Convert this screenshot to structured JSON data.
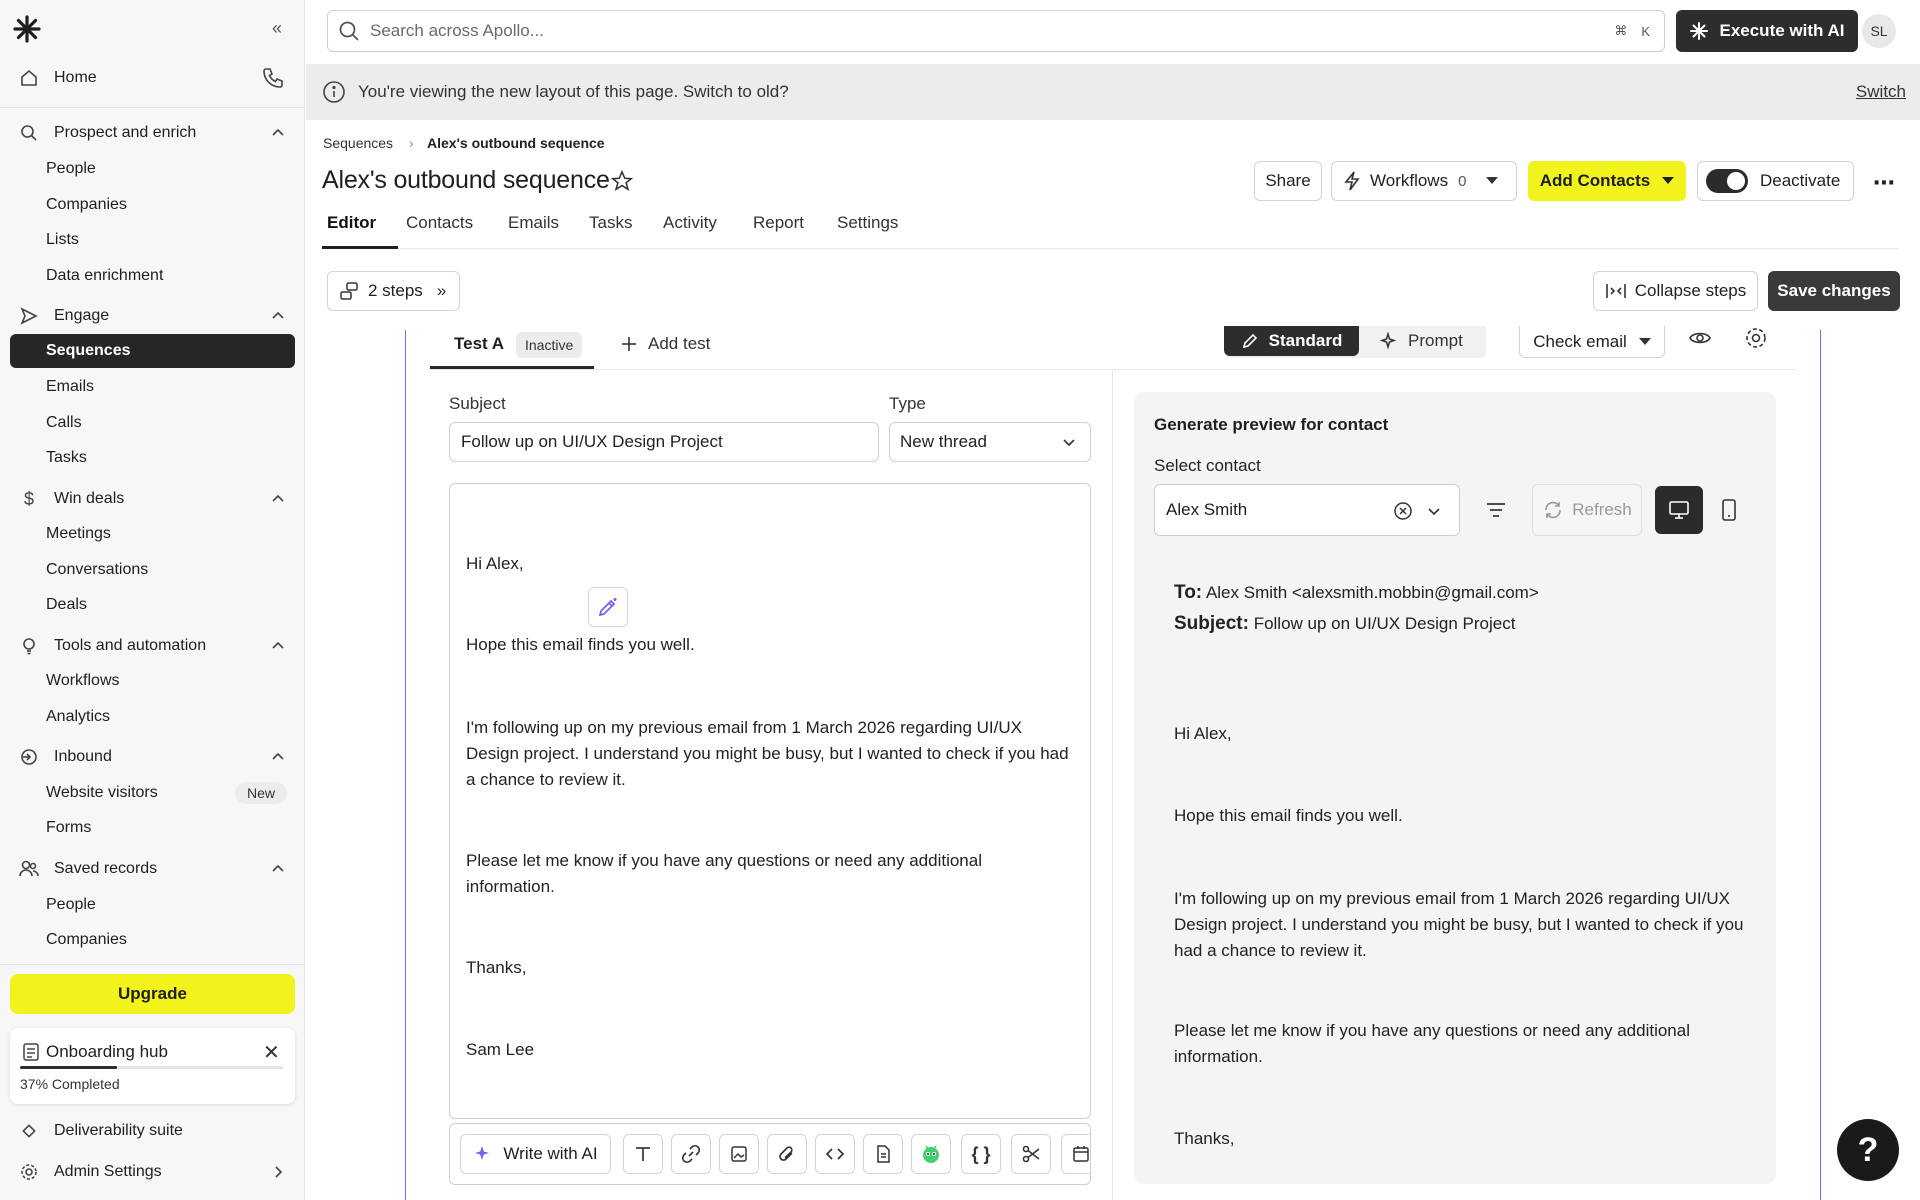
{
  "sidebar": {
    "home": "Home",
    "sections": {
      "prospect": "Prospect and enrich",
      "engage": "Engage",
      "win": "Win deals",
      "tools": "Tools and automation",
      "inbound": "Inbound",
      "saved": "Saved records"
    },
    "items": {
      "people": "People",
      "companies": "Companies",
      "lists": "Lists",
      "data_enrichment": "Data enrichment",
      "sequences": "Sequences",
      "emails": "Emails",
      "calls": "Calls",
      "tasks": "Tasks",
      "meetings": "Meetings",
      "conversations": "Conversations",
      "deals": "Deals",
      "workflows": "Workflows",
      "analytics": "Analytics",
      "website_visitors": "Website visitors",
      "new_badge": "New",
      "forms": "Forms",
      "saved_people": "People",
      "saved_companies": "Companies"
    },
    "upgrade": "Upgrade",
    "onboarding": {
      "title": "Onboarding hub",
      "progress_text": "37% Completed",
      "progress": 0.37
    },
    "deliverability": "Deliverability suite",
    "admin": "Admin Settings"
  },
  "topbar": {
    "search_placeholder": "Search across Apollo...",
    "shortcut_cmd": "⌘",
    "shortcut_key": "K",
    "execute_ai": "Execute with AI",
    "avatar": "SL"
  },
  "banner": {
    "text": "You're viewing the new layout of this page. Switch to old?",
    "link": "Switch"
  },
  "header": {
    "breadcrumb_root": "Sequences",
    "breadcrumb_current": "Alex's outbound sequence",
    "title": "Alex's outbound sequence",
    "share": "Share",
    "workflows": "Workflows",
    "workflows_count": "0",
    "add_contacts": "Add Contacts",
    "deactivate": "Deactivate"
  },
  "tabs": [
    "Editor",
    "Contacts",
    "Emails",
    "Tasks",
    "Activity",
    "Report",
    "Settings"
  ],
  "stepbar": {
    "steps": "2 steps",
    "collapse": "Collapse steps",
    "save": "Save changes"
  },
  "step": {
    "test_tab": "Test A",
    "test_status": "Inactive",
    "add_test": "Add test",
    "mode_standard": "Standard",
    "mode_prompt": "Prompt",
    "check_email": "Check email",
    "subject_label": "Subject",
    "subject_value": "Follow up on UI/UX Design Project",
    "type_label": "Type",
    "type_value": "New thread",
    "body": {
      "greeting": "Hi Alex,",
      "p1": "Hope this email finds you well.",
      "p2": "I'm following up on my previous email from 1 March 2026 regarding UI/UX Design project. I understand you might be busy, but I wanted to check if you had a chance to review it.",
      "p3": "Please let me know if you have any questions or need any additional information.",
      "signoff": "Thanks,",
      "name": "Sam Lee"
    },
    "write_ai": "Write with AI"
  },
  "preview": {
    "title": "Generate preview for contact",
    "select_label": "Select contact",
    "contact": "Alex Smith",
    "refresh": "Refresh",
    "to_label": "To:",
    "to_value": "Alex Smith <alexsmith.mobbin@gmail.com>",
    "subject_label": "Subject:",
    "subject_value": "Follow up on UI/UX Design Project",
    "greeting": "Hi Alex,",
    "p1": "Hope this email finds you well.",
    "p2": "I'm following up on my previous email from 1 March 2026 regarding UI/UX Design project. I understand you might be busy, but I wanted to check if you had a chance to review it.",
    "p3": "Please let me know if you have any questions or need any additional information.",
    "signoff": "Thanks,"
  },
  "help": "?",
  "colors": {
    "accent_yellow": "#f2f21d",
    "dark": "#2d2d2d",
    "card_border": "#6f6ff0"
  }
}
